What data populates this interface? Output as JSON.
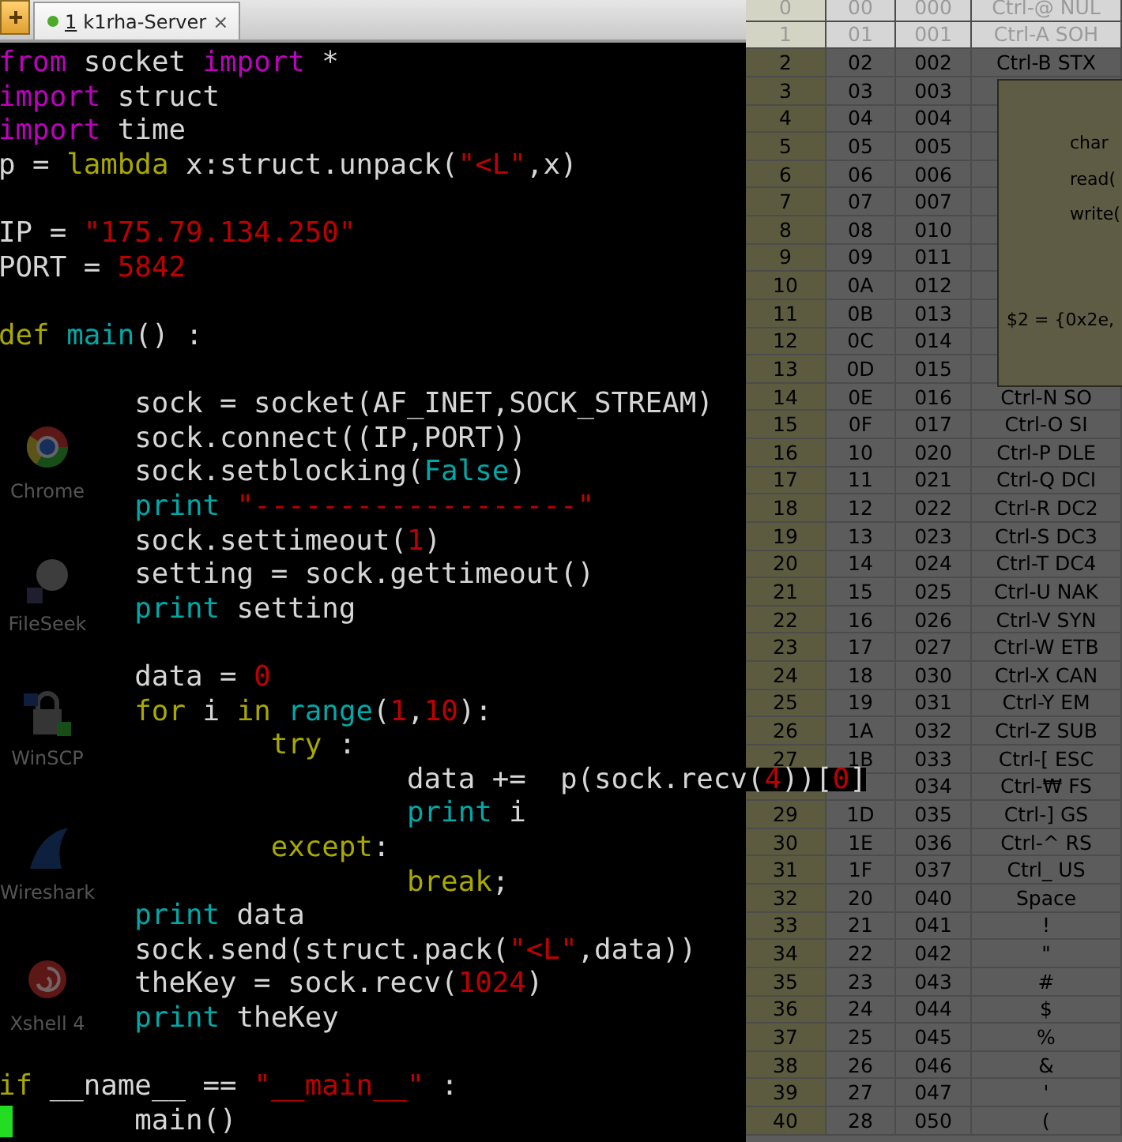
{
  "tab_bar": {
    "tabs": [
      {
        "number": "1",
        "title": "k1rha-Server",
        "selected": true,
        "connected": true,
        "close": "×"
      }
    ]
  },
  "desktop_icons": [
    {
      "label": "Chrome",
      "kind": "chrome"
    },
    {
      "label": "FileSeek",
      "kind": "fileseek"
    },
    {
      "label": "WinSCP",
      "kind": "winscp"
    },
    {
      "label": "Wireshark",
      "kind": "wireshark"
    },
    {
      "label": "Xshell 4",
      "kind": "xshell"
    }
  ],
  "code_lines": [
    {
      "kind": "code",
      "tokens": [
        {
          "kind": "keyword",
          "text": "from"
        },
        {
          "kind": "plain",
          "text": " socket "
        },
        {
          "kind": "keyword",
          "text": "import"
        },
        {
          "kind": "plain",
          "text": " *"
        }
      ]
    },
    {
      "kind": "code",
      "tokens": [
        {
          "kind": "keyword",
          "text": "import"
        },
        {
          "kind": "plain",
          "text": " struct"
        }
      ]
    },
    {
      "kind": "code",
      "tokens": [
        {
          "kind": "keyword",
          "text": "import"
        },
        {
          "kind": "plain",
          "text": " time"
        }
      ]
    },
    {
      "kind": "code",
      "tokens": [
        {
          "kind": "plain",
          "text": "p = "
        },
        {
          "kind": "control",
          "text": "lambda"
        },
        {
          "kind": "plain",
          "text": " x:struct.unpack("
        },
        {
          "kind": "literal",
          "text": "\"<L\""
        },
        {
          "kind": "plain",
          "text": ",x)"
        }
      ]
    },
    {
      "kind": "blank"
    },
    {
      "kind": "code",
      "tokens": [
        {
          "kind": "plain",
          "text": "IP = "
        },
        {
          "kind": "literal",
          "text": "\"175.79.134.250\""
        }
      ]
    },
    {
      "kind": "code",
      "tokens": [
        {
          "kind": "plain",
          "text": "PORT = "
        },
        {
          "kind": "literal",
          "text": "5842"
        }
      ]
    },
    {
      "kind": "blank"
    },
    {
      "kind": "code",
      "tokens": [
        {
          "kind": "control",
          "text": "def "
        },
        {
          "kind": "builtin",
          "text": "main"
        },
        {
          "kind": "plain",
          "text": "() :"
        }
      ],
      "children": [
        {
          "kind": "blank"
        },
        {
          "kind": "code",
          "tokens": [
            {
              "kind": "plain",
              "text": "sock = socket(AF_INET,SOCK_STREAM)"
            }
          ]
        },
        {
          "kind": "code",
          "tokens": [
            {
              "kind": "plain",
              "text": "sock.connect((IP,PORT))"
            }
          ]
        },
        {
          "kind": "code",
          "tokens": [
            {
              "kind": "plain",
              "text": "sock.setblocking("
            },
            {
              "kind": "builtin",
              "text": "False"
            },
            {
              "kind": "plain",
              "text": ")"
            }
          ]
        },
        {
          "kind": "code",
          "tokens": [
            {
              "kind": "builtin",
              "text": "print "
            },
            {
              "kind": "literal",
              "text": "\"-------------------\""
            }
          ]
        },
        {
          "kind": "code",
          "tokens": [
            {
              "kind": "plain",
              "text": "sock.settimeout("
            },
            {
              "kind": "literal",
              "text": "1"
            },
            {
              "kind": "plain",
              "text": ")"
            }
          ]
        },
        {
          "kind": "code",
          "tokens": [
            {
              "kind": "plain",
              "text": "setting = sock.gettimeout()"
            }
          ]
        },
        {
          "kind": "code",
          "tokens": [
            {
              "kind": "builtin",
              "text": "print"
            },
            {
              "kind": "plain",
              "text": " setting"
            }
          ]
        },
        {
          "kind": "blank"
        },
        {
          "kind": "code",
          "tokens": [
            {
              "kind": "plain",
              "text": "data = "
            },
            {
              "kind": "literal",
              "text": "0"
            }
          ]
        },
        {
          "kind": "code",
          "tokens": [
            {
              "kind": "control",
              "text": "for"
            },
            {
              "kind": "plain",
              "text": " i "
            },
            {
              "kind": "control",
              "text": "in "
            },
            {
              "kind": "builtin",
              "text": "range"
            },
            {
              "kind": "plain",
              "text": "("
            },
            {
              "kind": "literal",
              "text": "1"
            },
            {
              "kind": "plain",
              "text": ","
            },
            {
              "kind": "literal",
              "text": "10"
            },
            {
              "kind": "plain",
              "text": "):"
            }
          ],
          "children": [
            {
              "kind": "code",
              "tokens": [
                {
                  "kind": "control",
                  "text": "try"
                },
                {
                  "kind": "plain",
                  "text": " :"
                }
              ],
              "children": [
                {
                  "kind": "code",
                  "tokens": [
                    {
                      "kind": "plain",
                      "text": "data +=  p(sock.recv("
                    },
                    {
                      "kind": "literal",
                      "text": "4"
                    },
                    {
                      "kind": "plain",
                      "text": "))["
                    },
                    {
                      "kind": "literal",
                      "text": "0"
                    },
                    {
                      "kind": "plain",
                      "text": "]"
                    }
                  ]
                },
                {
                  "kind": "code",
                  "tokens": [
                    {
                      "kind": "builtin",
                      "text": "print"
                    },
                    {
                      "kind": "plain",
                      "text": " i"
                    }
                  ]
                }
              ]
            },
            {
              "kind": "code",
              "tokens": [
                {
                  "kind": "control",
                  "text": "except"
                },
                {
                  "kind": "plain",
                  "text": ":"
                }
              ],
              "children": [
                {
                  "kind": "code",
                  "tokens": [
                    {
                      "kind": "control",
                      "text": "break"
                    },
                    {
                      "kind": "plain",
                      "text": ";"
                    }
                  ]
                }
              ]
            }
          ]
        },
        {
          "kind": "code",
          "tokens": [
            {
              "kind": "builtin",
              "text": "print"
            },
            {
              "kind": "plain",
              "text": " data"
            }
          ]
        },
        {
          "kind": "code",
          "tokens": [
            {
              "kind": "plain",
              "text": "sock.send(struct.pack("
            },
            {
              "kind": "literal",
              "text": "\"<L\""
            },
            {
              "kind": "plain",
              "text": ",data))"
            }
          ]
        },
        {
          "kind": "code",
          "tokens": [
            {
              "kind": "plain",
              "text": "theKey = sock.recv("
            },
            {
              "kind": "literal",
              "text": "1024"
            },
            {
              "kind": "plain",
              "text": ")"
            }
          ]
        },
        {
          "kind": "code",
          "tokens": [
            {
              "kind": "builtin",
              "text": "print"
            },
            {
              "kind": "plain",
              "text": " theKey"
            }
          ]
        }
      ]
    },
    {
      "kind": "blank"
    },
    {
      "kind": "code",
      "tokens": [
        {
          "kind": "control",
          "text": "if"
        },
        {
          "kind": "plain",
          "text": " __name__ == "
        },
        {
          "kind": "literal",
          "text": "\"__main__\""
        },
        {
          "kind": "plain",
          "text": " :"
        }
      ],
      "children": [
        {
          "kind": "code",
          "tokens": [
            {
              "kind": "plain",
              "text": "main()"
            }
          ]
        }
      ]
    }
  ],
  "ascii_table": {
    "rows": [
      {
        "dec": "0",
        "hex": "00",
        "oct": "000",
        "char": "Ctrl-@ NUL"
      },
      {
        "dec": "1",
        "hex": "01",
        "oct": "001",
        "char": "Ctrl-A SOH"
      },
      {
        "dec": "2",
        "hex": "02",
        "oct": "002",
        "char": "Ctrl-B STX"
      },
      {
        "dec": "3",
        "hex": "03",
        "oct": "003"
      },
      {
        "dec": "4",
        "hex": "04",
        "oct": "004"
      },
      {
        "dec": "5",
        "hex": "05",
        "oct": "005"
      },
      {
        "dec": "6",
        "hex": "06",
        "oct": "006"
      },
      {
        "dec": "7",
        "hex": "07",
        "oct": "007"
      },
      {
        "dec": "8",
        "hex": "08",
        "oct": "010"
      },
      {
        "dec": "9",
        "hex": "09",
        "oct": "011"
      },
      {
        "dec": "10",
        "hex": "0A",
        "oct": "012"
      },
      {
        "dec": "11",
        "hex": "0B",
        "oct": "013"
      },
      {
        "dec": "12",
        "hex": "0C",
        "oct": "014"
      },
      {
        "dec": "13",
        "hex": "0D",
        "oct": "015"
      },
      {
        "dec": "14",
        "hex": "0E",
        "oct": "016",
        "char": "Ctrl-N SO"
      },
      {
        "dec": "15",
        "hex": "0F",
        "oct": "017",
        "char": "Ctrl-O SI"
      },
      {
        "dec": "16",
        "hex": "10",
        "oct": "020",
        "char": "Ctrl-P DLE"
      },
      {
        "dec": "17",
        "hex": "11",
        "oct": "021",
        "char": "Ctrl-Q DCI"
      },
      {
        "dec": "18",
        "hex": "12",
        "oct": "022",
        "char": "Ctrl-R DC2"
      },
      {
        "dec": "19",
        "hex": "13",
        "oct": "023",
        "char": "Ctrl-S DC3"
      },
      {
        "dec": "20",
        "hex": "14",
        "oct": "024",
        "char": "Ctrl-T DC4"
      },
      {
        "dec": "21",
        "hex": "15",
        "oct": "025",
        "char": "Ctrl-U NAK"
      },
      {
        "dec": "22",
        "hex": "16",
        "oct": "026",
        "char": "Ctrl-V SYN"
      },
      {
        "dec": "23",
        "hex": "17",
        "oct": "027",
        "char": "Ctrl-W ETB"
      },
      {
        "dec": "24",
        "hex": "18",
        "oct": "030",
        "char": "Ctrl-X CAN"
      },
      {
        "dec": "25",
        "hex": "19",
        "oct": "031",
        "char": "Ctrl-Y EM"
      },
      {
        "dec": "26",
        "hex": "1A",
        "oct": "032",
        "char": "Ctrl-Z SUB"
      },
      {
        "dec": "27",
        "hex": "1B",
        "oct": "033",
        "char": "Ctrl-[ ESC"
      },
      {
        "oct": "034",
        "char": "Ctrl-₩ FS"
      },
      {
        "dec": "29",
        "hex": "1D",
        "oct": "035",
        "char": "Ctrl-] GS"
      },
      {
        "dec": "30",
        "hex": "1E",
        "oct": "036",
        "char": "Ctrl-^ RS"
      },
      {
        "dec": "31",
        "hex": "1F",
        "oct": "037",
        "char": "Ctrl_ US"
      },
      {
        "dec": "32",
        "hex": "20",
        "oct": "040",
        "char": "Space"
      },
      {
        "dec": "33",
        "hex": "21",
        "oct": "041",
        "char": "!"
      },
      {
        "dec": "34",
        "hex": "22",
        "oct": "042",
        "char": "\""
      },
      {
        "dec": "35",
        "hex": "23",
        "oct": "043",
        "char": "#"
      },
      {
        "dec": "36",
        "hex": "24",
        "oct": "044",
        "char": "$"
      },
      {
        "dec": "37",
        "hex": "25",
        "oct": "045",
        "char": "%"
      },
      {
        "dec": "38",
        "hex": "26",
        "oct": "046",
        "char": "&"
      },
      {
        "dec": "39",
        "hex": "27",
        "oct": "047",
        "char": "'"
      },
      {
        "dec": "40",
        "hex": "28",
        "oct": "050",
        "char": "("
      }
    ]
  },
  "code_popup": {
    "lines": [
      "char",
      "read(",
      "write("
    ],
    "result": "$2 = {0x2e,"
  }
}
